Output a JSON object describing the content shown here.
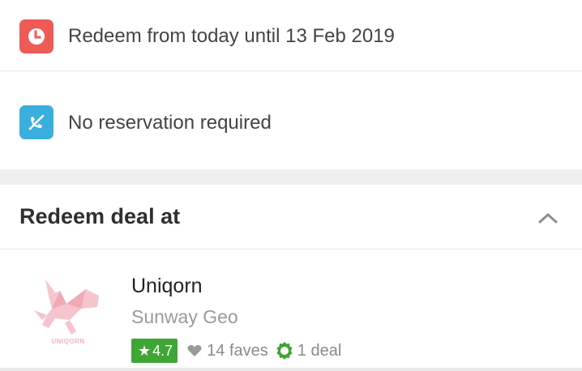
{
  "info": {
    "validity": {
      "icon": "clock-icon",
      "color": "#ee5b57",
      "text": "Redeem from today until 13 Feb 2019"
    },
    "reservation": {
      "icon": "no-phone-icon",
      "color": "#3aaedc",
      "text": "No reservation required"
    }
  },
  "section": {
    "title": "Redeem deal at",
    "toggle_icon": "chevron-up-icon"
  },
  "merchant": {
    "name": "Uniqorn",
    "location": "Sunway Geo",
    "logo_text": "UNIQORN",
    "rating": "4.7",
    "rating_color": "#3fa535",
    "faves": "14 faves",
    "deals": "1 deal",
    "accent_color": "#3fa535"
  }
}
